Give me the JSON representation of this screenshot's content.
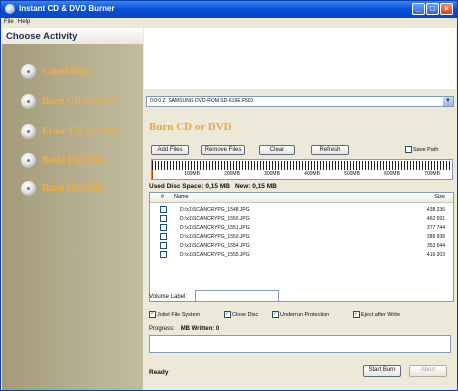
{
  "window": {
    "title": "Instant CD & DVD Burner"
  },
  "menu": [
    "File",
    "Help"
  ],
  "sidebar": {
    "heading": "Choose Activity",
    "items": [
      {
        "label": "Capabilities",
        "icon": "disc-icon"
      },
      {
        "label": "Burn CD or DVD",
        "icon": "disc-icon"
      },
      {
        "label": "Erase CD or DVD",
        "icon": "disc-icon"
      },
      {
        "label": "Build ISO File",
        "icon": "disc-icon"
      },
      {
        "label": "Burn ISO File",
        "icon": "disc-icon"
      }
    ]
  },
  "main": {
    "drive": "0:0:0 Z: SAMSUNG DVD-ROM SD-616E F501",
    "section_title": "Burn CD or DVD",
    "buttons": {
      "add": "Add Files",
      "remove": "Remove Files",
      "clear": "Clear",
      "refresh": "Refresh"
    },
    "save_path": {
      "label": "Save Path",
      "checked": false
    },
    "capacity": {
      "ticks": [
        "100MB",
        "200MB",
        "300MB",
        "400MB",
        "500MB",
        "600MB",
        "700MB"
      ],
      "used_fraction": 0.0
    },
    "disk_info": {
      "used": "Used Disc Space: 0,15 MB",
      "new": "New: 0,15 MB"
    },
    "file_list": {
      "columns": [
        "#",
        "Name",
        "Size"
      ],
      "rows": [
        {
          "name": "D:\\x1\\SCANCRYPG_1548.JPG",
          "size": "438 236"
        },
        {
          "name": "D:\\x1\\SCANCRYPG_1550.JPG",
          "size": "462 691"
        },
        {
          "name": "D:\\x1\\SCANCRYPG_1551.JPG",
          "size": "377 744"
        },
        {
          "name": "D:\\x1\\SCANCRYPG_1553.JPG",
          "size": "389 938"
        },
        {
          "name": "D:\\x1\\SCANCRYPG_1554.JPG",
          "size": "353 644"
        },
        {
          "name": "D:\\x1\\SCANCRYPG_1555.JPG",
          "size": "416 203"
        }
      ]
    },
    "volume_label": {
      "label": "Volume Label:",
      "value": ""
    },
    "options": [
      {
        "label": "Joliet File System",
        "checked": true
      },
      {
        "label": "Close Disc",
        "checked": true
      },
      {
        "label": "Underrun Protection",
        "checked": true
      },
      {
        "label": "Eject after Write",
        "checked": true
      }
    ],
    "progress": {
      "label": "Progress:",
      "written": "MB Written: 0",
      "fraction": 0.0
    },
    "status": "Ready",
    "start_button": "Start Burn",
    "abort_button": "Abort"
  }
}
